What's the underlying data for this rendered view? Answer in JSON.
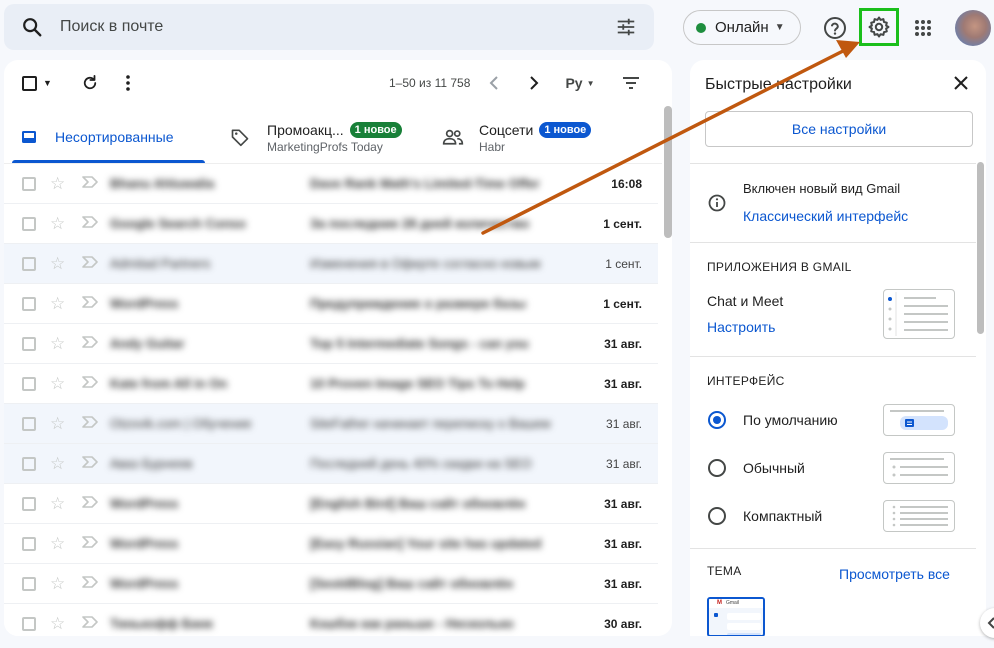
{
  "search": {
    "placeholder": "Поиск в почте"
  },
  "header": {
    "status_label": "Онлайн"
  },
  "toolbar": {
    "counter": "1–50 из 11 758",
    "input_tool_label": "Ру"
  },
  "tabs": [
    {
      "label": "Несортированные",
      "active": true
    },
    {
      "label": "Промоакц...",
      "badge": "1 новое",
      "sub": "MarketingProfs Today"
    },
    {
      "label": "Соцсети",
      "badge": "1 новое",
      "sub": "Habr"
    }
  ],
  "emails": [
    {
      "sender": "Bhanu Ahluwalia",
      "subject": "Dave Rank Math's Limited-Time Offer",
      "date": "16:08",
      "unread": true
    },
    {
      "sender": "Google Search Conso",
      "subject": "За последние 28 дней количество",
      "date": "1 сент.",
      "unread": true
    },
    {
      "sender": "Admitad Partners",
      "subject": "Изменения в Оферте согласно новым",
      "date": "1 сент.",
      "unread": false
    },
    {
      "sender": "WordPress",
      "subject": "Предупреждение о размере базы",
      "date": "1 сент.",
      "unread": true
    },
    {
      "sender": "Andy Guitar",
      "subject": "Top 5 Intermediate Songs - can you",
      "date": "31 авг.",
      "unread": true
    },
    {
      "sender": "Kate from All in On",
      "subject": "10 Proven Image SEO Tips To Help",
      "date": "31 авг.",
      "unread": true
    },
    {
      "sender": "Otzovik.com | Обучение",
      "subject": "SiteFather начинает переписку о Вашем",
      "date": "31 авг.",
      "unread": false
    },
    {
      "sender": "Аваз Бурнеев",
      "subject": "Последний день 40% скидки на SEO",
      "date": "31 авг.",
      "unread": false
    },
    {
      "sender": "WordPress",
      "subject": "[English Bird] Ваш сайт обновлён",
      "date": "31 авг.",
      "unread": true
    },
    {
      "sender": "WordPress",
      "subject": "[Easy Russian] Your site has updated",
      "date": "31 авг.",
      "unread": true
    },
    {
      "sender": "WordPress",
      "subject": "[SeoIdBlog] Ваш сайт обновлён",
      "date": "31 авг.",
      "unread": true
    },
    {
      "sender": "Тинькофф Банк",
      "subject": "Кэшбэк как раньше - Несколько",
      "date": "30 авг.",
      "unread": true
    }
  ],
  "quick_settings": {
    "title": "Быстрые настройки",
    "all_settings": "Все настройки",
    "new_view_text": "Включен новый вид Gmail",
    "classic_link": "Классический интерфейс",
    "apps_heading": "ПРИЛОЖЕНИЯ В GMAIL",
    "chat_meet": "Chat и Meet",
    "configure": "Настроить",
    "interface_heading": "ИНТЕРФЕЙС",
    "density": [
      {
        "label": "По умолчанию",
        "selected": true
      },
      {
        "label": "Обычный",
        "selected": false
      },
      {
        "label": "Компактный",
        "selected": false
      }
    ],
    "theme_heading": "ТЕМА",
    "view_all": "Просмотреть все",
    "theme_preview_text": "Gmail"
  },
  "colors": {
    "accent": "#0b57d0",
    "highlight": "#1bbf1b",
    "arrow": "#c0580f",
    "online": "#1e8e3e"
  }
}
